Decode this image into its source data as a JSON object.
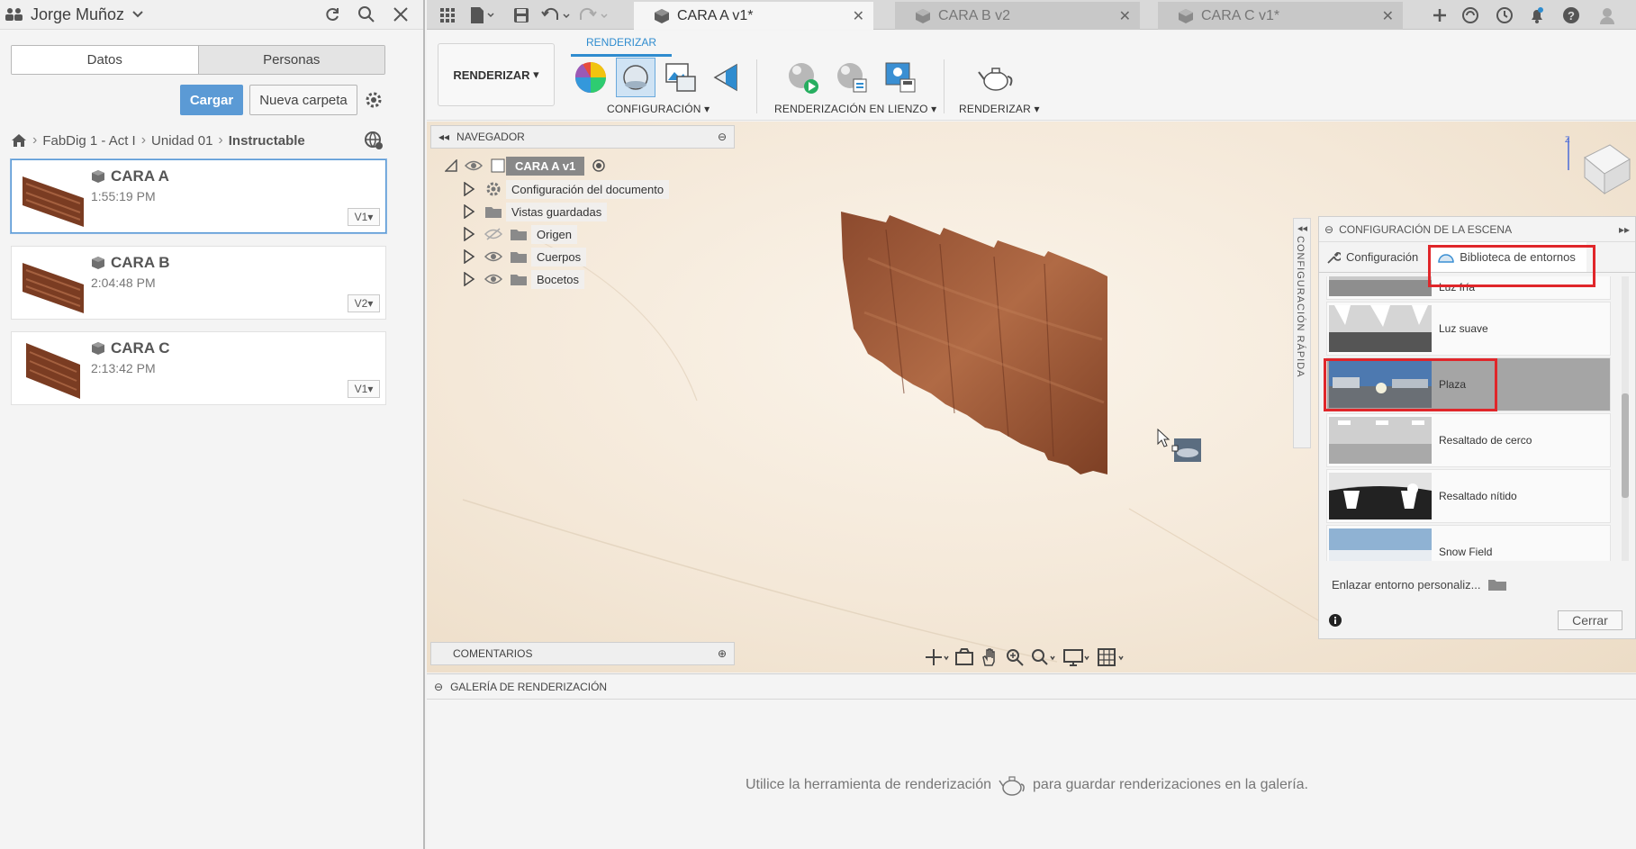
{
  "left_panel": {
    "user": "Jorge Muñoz",
    "tabs": {
      "data": "Datos",
      "people": "Personas"
    },
    "upload_label": "Cargar",
    "new_folder_label": "Nueva carpeta",
    "breadcrumb": [
      "FabDig 1 - Act I",
      "Unidad 01",
      "Instructable"
    ],
    "files": [
      {
        "name": "CARA A",
        "time": "1:55:19 PM",
        "version": "V1"
      },
      {
        "name": "CARA B",
        "time": "2:04:48 PM",
        "version": "V2"
      },
      {
        "name": "CARA C",
        "time": "2:13:42 PM",
        "version": "V1"
      }
    ]
  },
  "tabs": [
    {
      "label": "CARA A v1*"
    },
    {
      "label": "CARA B v2"
    },
    {
      "label": "CARA C v1*"
    }
  ],
  "toolbar": {
    "workspace": "RENDERIZAR",
    "tab_title": "RENDERIZAR",
    "groups": {
      "setup": "CONFIGURACIÓN",
      "canvas_render": "RENDERIZACIÓN EN LIENZO",
      "render": "RENDERIZAR"
    }
  },
  "browser": {
    "title": "NAVEGADOR",
    "root": "CARA A v1",
    "items": [
      "Configuración del documento",
      "Vistas guardadas",
      "Origen",
      "Cuerpos",
      "Bocetos"
    ],
    "comments": "COMENTARIOS"
  },
  "scene_settings": {
    "title": "CONFIGURACIÓN DE LA ESCENA",
    "tab_settings": "Configuración",
    "tab_library": "Biblioteca de entornos",
    "quick_label": "CONFIGURACIÓN RÁPIDA",
    "environments": [
      "Luz fría",
      "Luz suave",
      "Plaza",
      "Resaltado de cerco",
      "Resaltado nítido",
      "Snow Field"
    ],
    "selected": "Plaza",
    "custom_link": "Enlazar entorno personaliz...",
    "close_label": "Cerrar"
  },
  "gallery": {
    "title": "GALERÍA DE RENDERIZACIÓN",
    "message_pre": "Utilice la herramienta de renderización",
    "message_post": "para guardar renderizaciones en la galería."
  },
  "colors": {
    "accent": "#2f8ccf",
    "upload_button": "#5b9ad5",
    "highlight": "#e0262a",
    "wood": "#9a5a3c"
  }
}
